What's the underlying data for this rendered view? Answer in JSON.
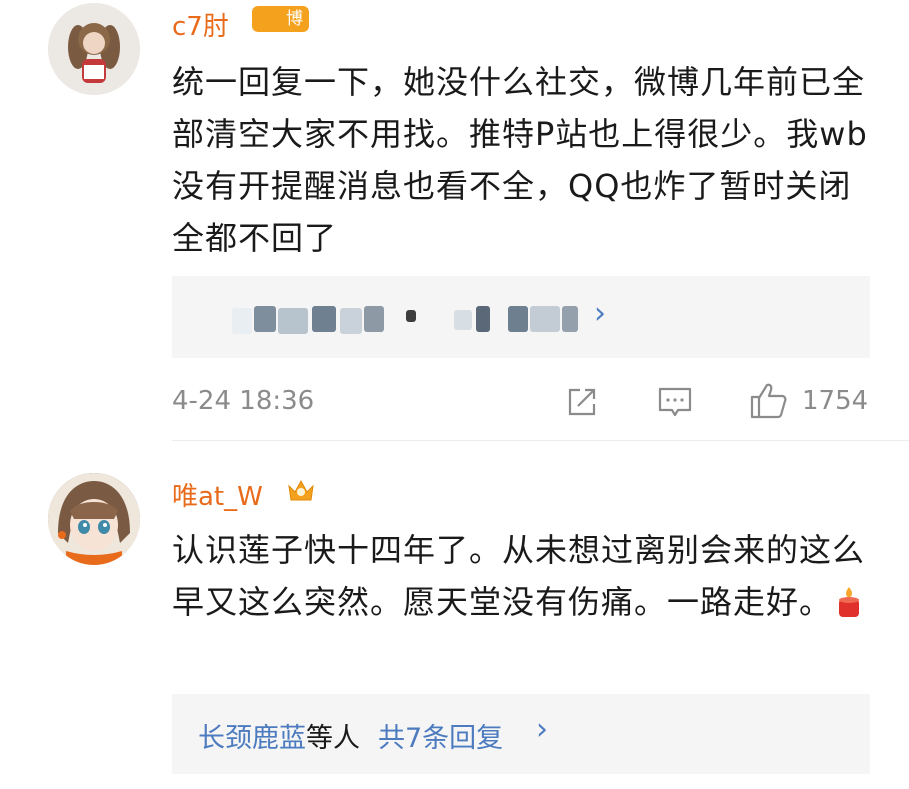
{
  "comments": [
    {
      "username": "c7肘",
      "badge": "博主",
      "text": "统一回复一下，她没什么社交，微博几年前已全部清空大家不用找。推特P站也上得很少。我wb没有开提醒消息也看不全，QQ也炸了暂时关闭全都不回了",
      "quote_link_arrow": "›",
      "time": "4-24 18:36",
      "likes": "1754"
    },
    {
      "username": "唯at_W",
      "text": "认识莲子快十四年了。从未想过离别会来的这么早又这么突然。愿天堂没有伤痛。一路走好。",
      "emoji": "candle-icon",
      "replies": {
        "name": "长颈鹿蓝",
        "suffix": "等人",
        "count_label": "共7条回复",
        "arrow": "›"
      }
    }
  ],
  "colors": {
    "username": "#e86b1c",
    "badge": "#f4a21e",
    "link": "#4c7bbf",
    "meta": "#8b8b8b",
    "text": "#1a1a1a",
    "panel": "#f5f5f5"
  }
}
